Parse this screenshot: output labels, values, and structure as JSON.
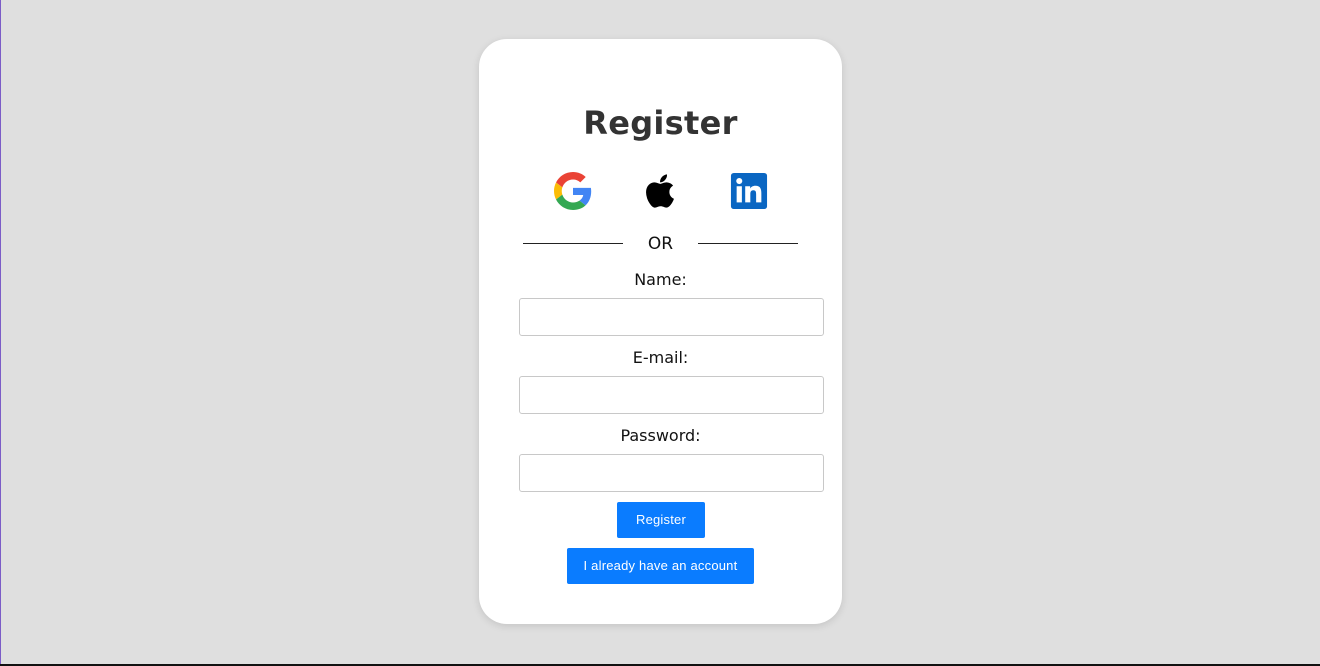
{
  "register_card": {
    "title": "Register",
    "social_login": {
      "google_icon": "google-icon",
      "apple_icon": "apple-icon",
      "linkedin_icon": "linkedin-icon"
    },
    "separator_text": "OR",
    "fields": {
      "name_label": "Name:",
      "name_value": "",
      "email_label": "E-mail:",
      "email_value": "",
      "password_label": "Password:",
      "password_value": ""
    },
    "register_button": "Register",
    "login_button": "I already have an account"
  },
  "colors": {
    "background": "#dfdfdf",
    "card": "#ffffff",
    "button": "#0a7cff",
    "title_text": "#333333",
    "linkedin_blue": "#0a66c2"
  }
}
